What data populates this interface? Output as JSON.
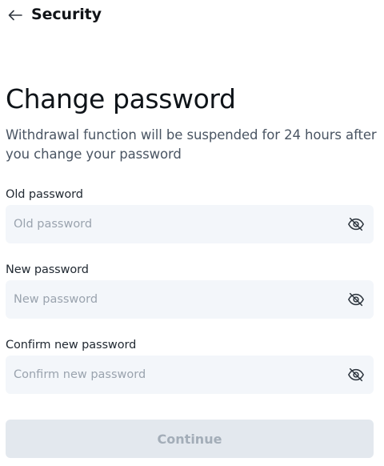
{
  "header": {
    "back_icon": "arrow-left-icon",
    "title": "Security"
  },
  "page": {
    "title": "Change password",
    "description": "Withdrawal function will be suspended for 24 hours after you change your password"
  },
  "form": {
    "fields": [
      {
        "label": "Old password",
        "placeholder": "Old password",
        "value": "",
        "toggle_icon": "eye-off-icon"
      },
      {
        "label": "New password",
        "placeholder": "New password",
        "value": "",
        "toggle_icon": "eye-off-icon"
      },
      {
        "label": "Confirm new password",
        "placeholder": "Confirm new password",
        "value": "",
        "toggle_icon": "eye-off-icon"
      }
    ],
    "submit_label": "Continue",
    "submit_disabled": true
  },
  "colors": {
    "text_primary": "#0f1419",
    "text_secondary": "#4a5563",
    "placeholder": "#9aa3ae",
    "field_background": "#f3f6fa",
    "button_disabled_background": "#e3e8ee",
    "button_disabled_text": "#a3adb8"
  }
}
